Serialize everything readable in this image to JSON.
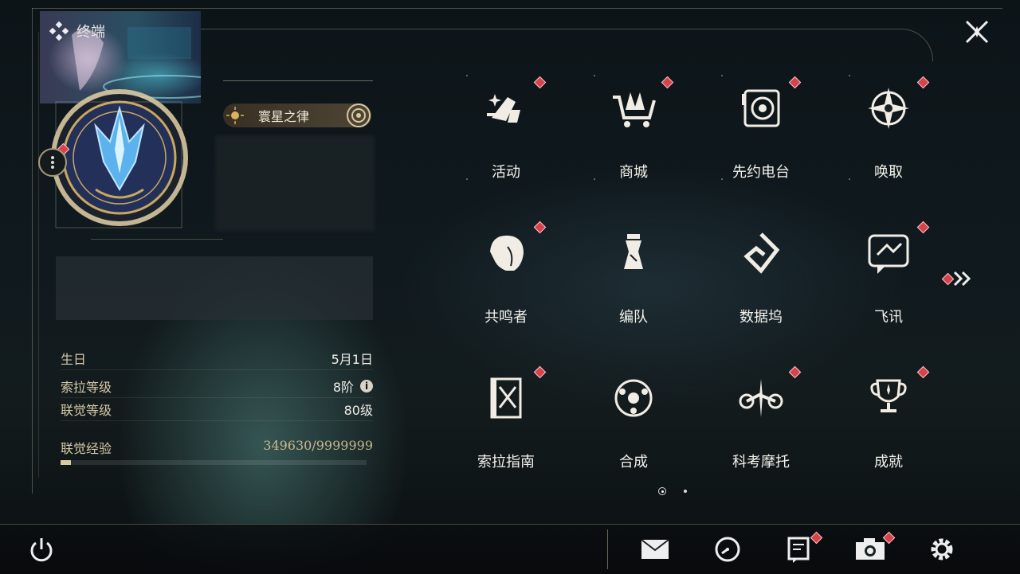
{
  "header": {
    "title": "终端"
  },
  "profile": {
    "title_badge": "寰星之律",
    "stats": [
      {
        "label": "生日",
        "value": "5月1日"
      },
      {
        "label": "索拉等级",
        "value": "8阶"
      },
      {
        "label": "联觉等级",
        "value": "80级"
      }
    ],
    "exp": {
      "label": "联觉经验",
      "value": "349630/9999999",
      "progress_fraction": 0.035
    }
  },
  "menu": [
    {
      "label": "活动",
      "icon": "activity-icon",
      "badge": true
    },
    {
      "label": "商城",
      "icon": "shop-cart-icon",
      "badge": true
    },
    {
      "label": "先约电台",
      "icon": "radio-icon",
      "badge": true
    },
    {
      "label": "唤取",
      "icon": "summon-star-icon",
      "badge": true
    },
    {
      "label": "共鸣者",
      "icon": "character-head-icon",
      "badge": true
    },
    {
      "label": "编队",
      "icon": "chess-team-icon",
      "badge": false
    },
    {
      "label": "数据坞",
      "icon": "data-dock-icon",
      "badge": false
    },
    {
      "label": "飞讯",
      "icon": "message-icon",
      "badge": true
    },
    {
      "label": "索拉指南",
      "icon": "guide-book-icon",
      "badge": true
    },
    {
      "label": "合成",
      "icon": "synthesis-icon",
      "badge": false
    },
    {
      "label": "科考摩托",
      "icon": "motorbike-icon",
      "badge": true
    },
    {
      "label": "成就",
      "icon": "trophy-icon",
      "badge": true
    }
  ],
  "pager": {
    "current": 1,
    "total": 2
  },
  "bottom_bar": {
    "icons": [
      "power-icon",
      "mail-icon",
      "clock-icon",
      "notice-icon",
      "camera-icon",
      "settings-gear-icon"
    ]
  },
  "colors": {
    "badge_red": "#d8424a",
    "accent_gold": "#c9b98c",
    "text": "#f3f1ea"
  }
}
